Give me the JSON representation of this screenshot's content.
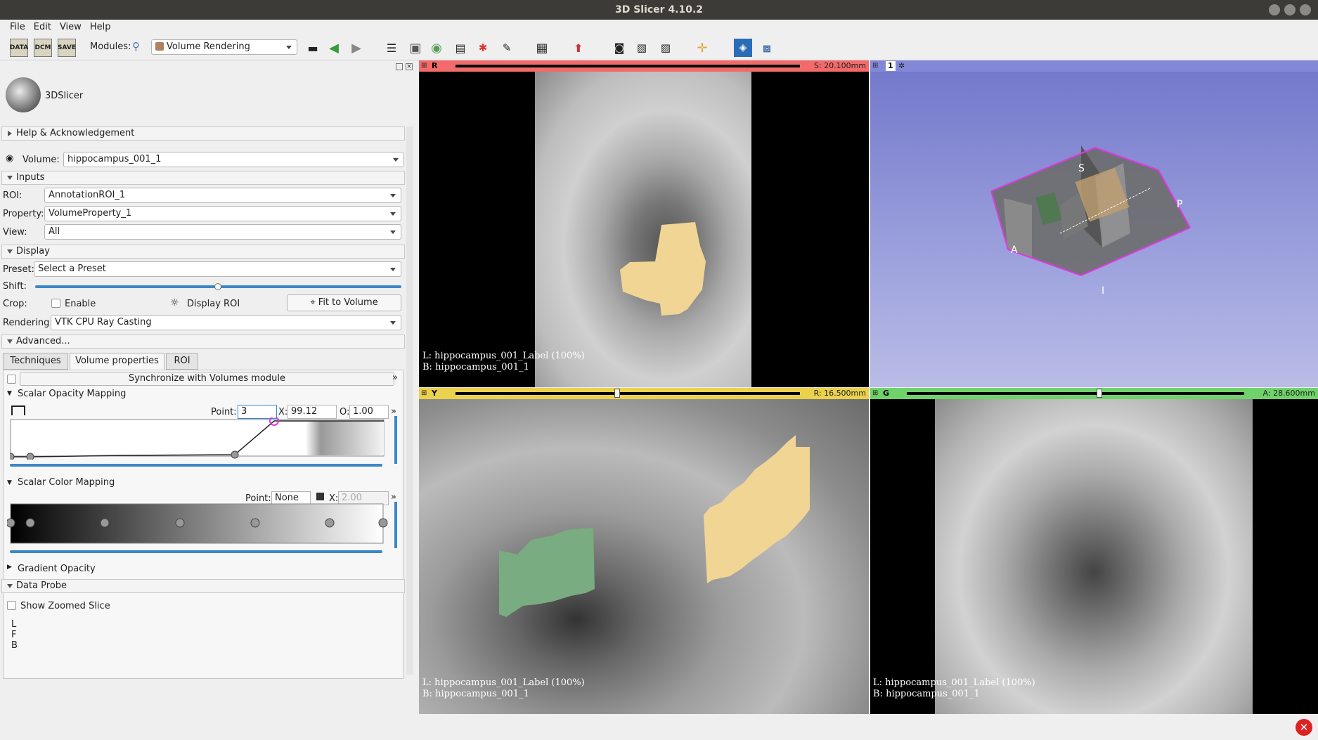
{
  "window": {
    "title": "3D Slicer 4.10.2"
  },
  "menu": [
    "File",
    "Edit",
    "View",
    "Help"
  ],
  "toolbar": {
    "data_label": "DATA",
    "dcm_label": "DCM",
    "save_label": "SAVE",
    "modules_label": "Modules:",
    "module_selected": "Volume Rendering"
  },
  "logo_text": "3DSlicer",
  "help_section": "Help & Acknowledgement",
  "volume": {
    "label": "Volume:",
    "value": "hippocampus_001_1"
  },
  "inputs": {
    "title": "Inputs",
    "roi_label": "ROI:",
    "roi_value": "AnnotationROI_1",
    "property_label": "Property:",
    "property_value": "VolumeProperty_1",
    "view_label": "View:",
    "view_value": "All"
  },
  "display": {
    "title": "Display",
    "preset_label": "Preset:",
    "preset_value": "Select a Preset",
    "shift_label": "Shift:",
    "crop_label": "Crop:",
    "enable_label": "Enable",
    "display_roi_label": "Display ROI",
    "fit_label": "Fit to Volume",
    "rendering_label": "Rendering:",
    "rendering_value": "VTK CPU Ray Casting"
  },
  "advanced": {
    "title": "Advanced...",
    "tabs": [
      "Techniques",
      "Volume properties",
      "ROI"
    ],
    "sync_label": "Synchronize with Volumes module",
    "scalar_opacity": {
      "title": "Scalar Opacity Mapping",
      "point_label": "Point:",
      "point_value": "3",
      "x_label": "X:",
      "x_value": "99.12",
      "o_label": "O:",
      "o_value": "1.00"
    },
    "scalar_color": {
      "title": "Scalar Color Mapping",
      "point_label": "Point:",
      "point_value": "None",
      "x_label": "X:",
      "x_value": "2.00"
    },
    "gradient_title": "Gradient Opacity"
  },
  "data_probe": {
    "title": "Data Probe",
    "show_zoomed": "Show Zoomed Slice",
    "lines": [
      "L",
      "F",
      "B"
    ]
  },
  "views": {
    "red": {
      "letter": "R",
      "value": "S: 20.100mm",
      "color": "#f26a6a",
      "overlay": [
        "L: hippocampus_001_Label (100%)",
        "B: hippocampus_001_1"
      ]
    },
    "threed": {
      "letter": "1"
    },
    "yellow": {
      "letter": "Y",
      "value": "R: 16.500mm",
      "color": "#ead24c",
      "overlay": [
        "L: hippocampus_001_Label (100%)",
        "B: hippocampus_001_1"
      ]
    },
    "green": {
      "letter": "G",
      "value": "A: 28.600mm",
      "color": "#6fd26a",
      "overlay": [
        "L: hippocampus_001_Label (100%)",
        "B: hippocampus_001_1"
      ]
    },
    "orientation_labels": [
      "S",
      "P",
      "A",
      "I"
    ]
  },
  "colors": {
    "label_tan": "#f0d594",
    "label_green": "#79ac80",
    "roi_magenta": "#e038e0",
    "sky": "#7f85d4"
  }
}
